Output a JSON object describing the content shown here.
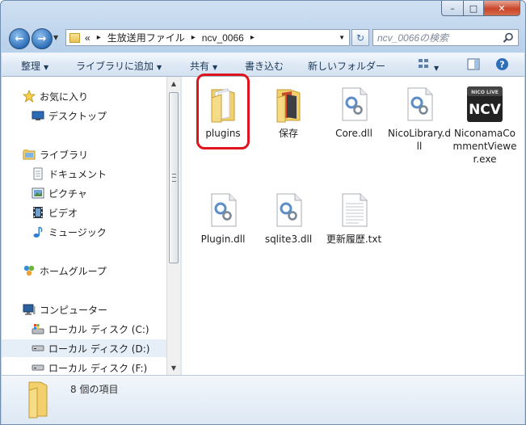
{
  "window": {
    "buttons": {
      "minimize": "–",
      "maximize": "□",
      "close": "✕"
    }
  },
  "address": {
    "overflow": "«",
    "crumbs": [
      "生放送用ファイル",
      "ncv_0066"
    ],
    "separator": "▸"
  },
  "search": {
    "placeholder": "ncv_0066の検索"
  },
  "toolbar": {
    "organize": "整理",
    "add_to_library": "ライブラリに追加",
    "share": "共有",
    "burn": "書き込む",
    "new_folder": "新しいフォルダー"
  },
  "nav": {
    "favorites": "お気に入り",
    "desktop": "デスクトップ",
    "libraries": "ライブラリ",
    "documents": "ドキュメント",
    "pictures": "ピクチャ",
    "videos": "ビデオ",
    "music": "ミュージック",
    "homegroup": "ホームグループ",
    "computer": "コンピューター",
    "drive_c": "ローカル ディスク (C:)",
    "drive_d": "ローカル ディスク (D:)",
    "drive_f": "ローカル ディスク (F:)"
  },
  "files": [
    {
      "name": "plugins",
      "type": "folder"
    },
    {
      "name": "保存",
      "type": "folder"
    },
    {
      "name": "Core.dll",
      "type": "dll"
    },
    {
      "name": "NicoLibrary.dll",
      "type": "dll"
    },
    {
      "name": "NiconamaCommentViewer.exe",
      "type": "exe"
    },
    {
      "name": "Plugin.dll",
      "type": "dll"
    },
    {
      "name": "sqlite3.dll",
      "type": "dll"
    },
    {
      "name": "更新履歴.txt",
      "type": "txt"
    }
  ],
  "exe_icon": {
    "top": "NICO LIVE",
    "main": "NCV"
  },
  "details": {
    "count_text": "8 個の項目"
  },
  "colors": {
    "highlight": "#e0141e",
    "accent": "#2f6fb8"
  }
}
